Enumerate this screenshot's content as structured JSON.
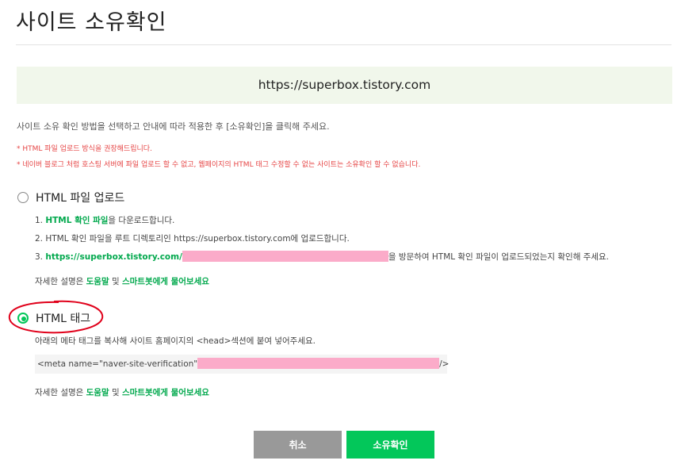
{
  "page": {
    "title": "사이트 소유확인"
  },
  "site": {
    "url": "https://superbox.tistory.com"
  },
  "instruction": "사이트 소유 확인 방법을 선택하고 안내에 따라 적용한 후 [소유확인]을 클릭해 주세요.",
  "warnings": [
    "* HTML 파일 업로드 방식을 권장해드립니다.",
    "* 네이버 블로그 처럼 호스팅 서버에 파일 업로드 할 수 없고, 웹페이지의 HTML 태그 수정할 수 없는 사이트는 소유확인 할 수 없습니다."
  ],
  "option_file": {
    "label": "HTML 파일 업로드",
    "selected": false,
    "step1_prefix": "1. ",
    "step1_link": "HTML 확인 파일",
    "step1_suffix": "을 다운로드합니다.",
    "step2": "2. HTML 확인 파일을 루트 디렉토리인 https://superbox.tistory.com에 업로드합니다.",
    "step3_prefix": "3. ",
    "step3_link": "https://superbox.tistory.com/",
    "step3_suffix": "을 방문하여 HTML 확인 파일이 업로드되었는지 확인해 주세요."
  },
  "option_tag": {
    "label": "HTML 태그",
    "selected": true,
    "desc": "아래의 메타 태그를 복사해 사이트 홈페이지의 <head>섹션에 붙여 넣어주세요.",
    "meta_prefix": "<meta name=\"naver-site-verification\"",
    "meta_suffix": "/>"
  },
  "help": {
    "prefix": "자세한 설명은 ",
    "link1": "도움말",
    "middle": " 및 ",
    "link2": "스마트봇에게 물어보세요"
  },
  "buttons": {
    "cancel": "취소",
    "confirm": "소유확인"
  },
  "colors": {
    "accent": "#03c75a",
    "link": "#03a94e",
    "warning": "#e64545",
    "url_bg": "#f1f7eb",
    "cancel_bg": "#999999",
    "annotation": "#e0001a"
  }
}
